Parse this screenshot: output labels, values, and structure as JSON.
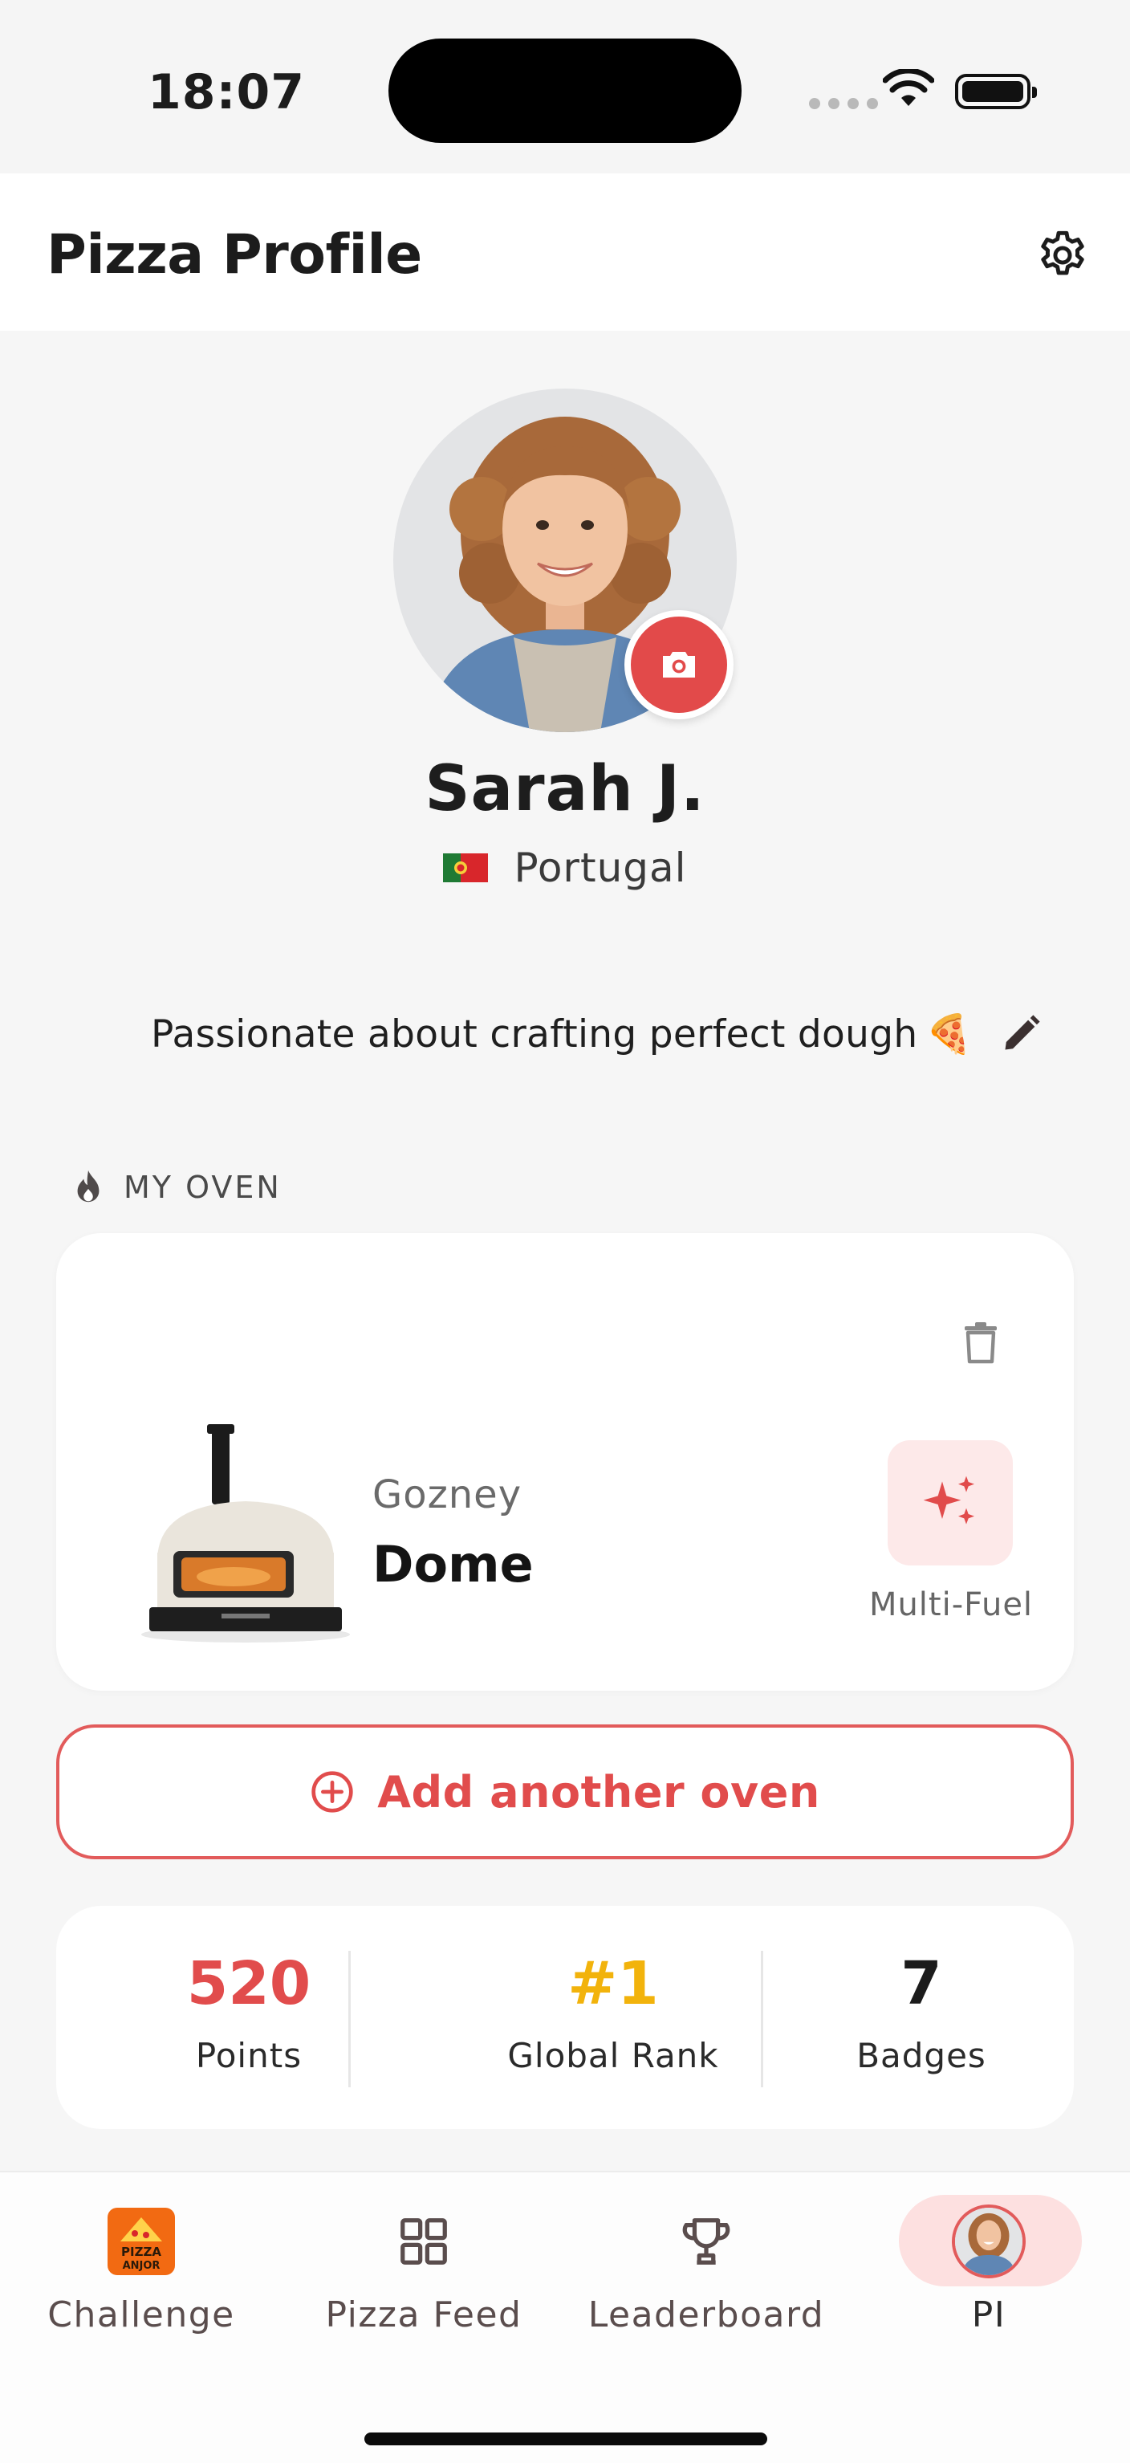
{
  "status_bar": {
    "time": "18:07"
  },
  "header": {
    "title": "Pizza Profile",
    "settings_icon": "gear-icon"
  },
  "profile": {
    "name": "Sarah J.",
    "country": "Portugal",
    "bio": "Passionate about crafting perfect dough",
    "bio_emoji": "🍕",
    "camera_icon": "camera-icon",
    "edit_icon": "pencil-icon"
  },
  "oven_section": {
    "label": "MY OVEN",
    "icon": "flame-icon",
    "oven": {
      "brand": "Gozney",
      "model": "Dome",
      "fuel_type": "Multi-Fuel",
      "fuel_icon": "sparkles-icon"
    },
    "delete_icon": "trash-icon",
    "add_button_label": "Add another oven"
  },
  "stats": {
    "points": {
      "value": "520",
      "label": "Points"
    },
    "rank": {
      "value": "#1",
      "label": "Global Rank"
    },
    "badges": {
      "value": "7",
      "label": "Badges"
    }
  },
  "nav": {
    "items": [
      {
        "label": "Challenge",
        "icon": "challenge-logo-icon"
      },
      {
        "label": "Pizza Feed",
        "icon": "grid-icon"
      },
      {
        "label": "Leaderboard",
        "icon": "trophy-icon"
      },
      {
        "label": "PI",
        "icon": "avatar-icon",
        "active": true
      }
    ],
    "challenge_logo_line1": "PIZZA",
    "challenge_logo_line2": "ANJOR"
  },
  "colors": {
    "accent": "#e14c4c",
    "gold": "#f2b30c",
    "accent_soft": "#fde9e9",
    "background": "#f6f6f6"
  }
}
